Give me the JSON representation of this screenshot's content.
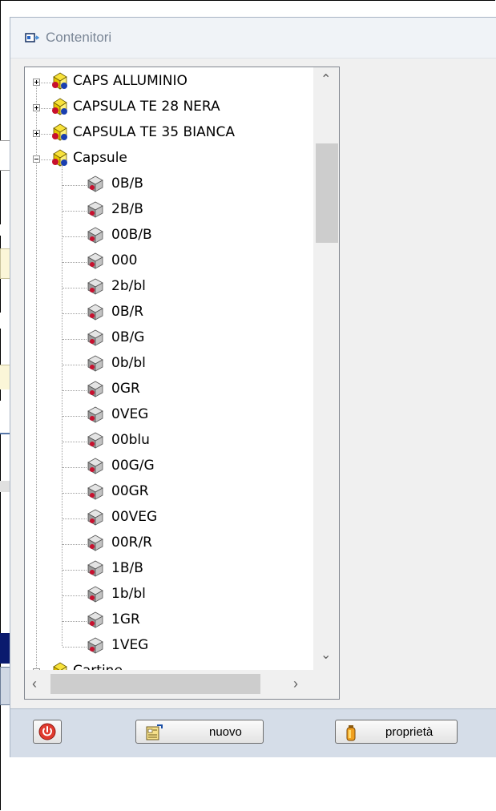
{
  "window": {
    "title": "Contenitori"
  },
  "tree": {
    "groups": [
      {
        "label": "CAPS ALLUMINIO",
        "expanded": false
      },
      {
        "label": "CAPSULA TE 28 NERA",
        "expanded": false
      },
      {
        "label": "CAPSULA TE 35 BIANCA",
        "expanded": false
      },
      {
        "label": "Capsule",
        "expanded": true,
        "children": [
          "0B/B",
          "2B/B",
          "00B/B",
          "000",
          "2b/bl",
          "0B/R",
          "0B/G",
          "0b/bl",
          "0GR",
          "0VEG",
          "00blu",
          "00G/G",
          "00GR",
          "00VEG",
          "00R/R",
          "1B/B",
          "1b/bl",
          "1GR",
          "1VEG"
        ]
      },
      {
        "label": "Cartine",
        "expanded": false
      }
    ]
  },
  "toolbar": {
    "power_icon": "power-icon",
    "new_label": "nuovo",
    "properties_label": "proprietà"
  },
  "colors": {
    "toolbar_bg": "#d5dde8",
    "window_bg": "#f0f0f0"
  }
}
